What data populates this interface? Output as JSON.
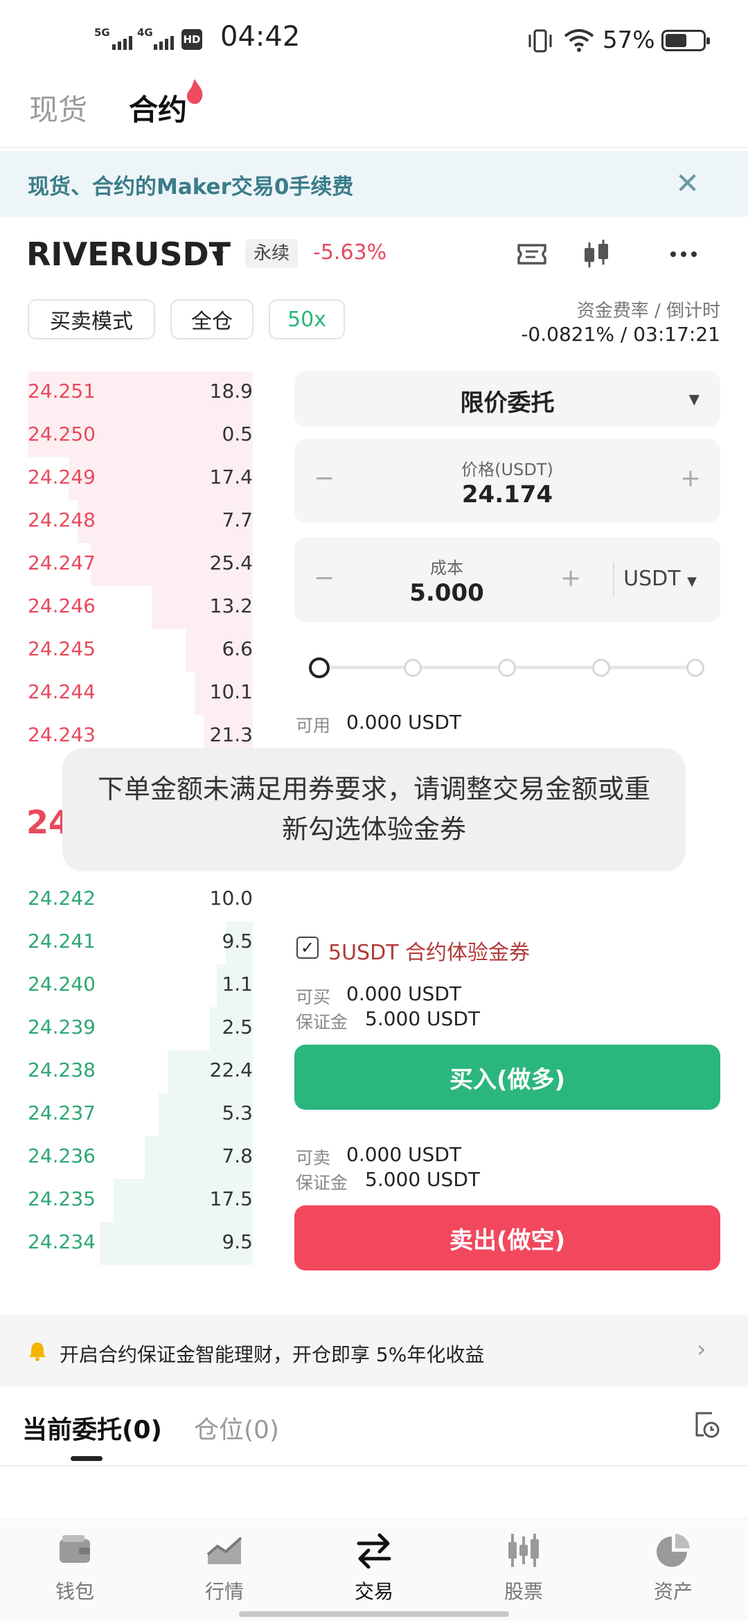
{
  "status_bar": {
    "net1": "5G",
    "net2": "4G",
    "hd": "HD",
    "time": "04:42",
    "battery": "57%"
  },
  "top_tabs": {
    "spot": "现货",
    "contract": "合约"
  },
  "banner": {
    "text": "现货、合约的Maker交易0手续费",
    "close": "✕"
  },
  "pair": {
    "symbol": "RIVERUSDT",
    "type_tag": "永续",
    "change": "-5.63%"
  },
  "mode_pills": {
    "mode": "买卖模式",
    "margin": "全仓",
    "leverage": "50x"
  },
  "funding": {
    "label": "资金费率 / 倒计时",
    "value": "-0.0821% / 03:17:21"
  },
  "asks": [
    {
      "price": "24.251",
      "qty": "18.9",
      "depth": 1.0
    },
    {
      "price": "24.250",
      "qty": "0.5",
      "depth": 1.0
    },
    {
      "price": "24.249",
      "qty": "17.4",
      "depth": 0.82
    },
    {
      "price": "24.248",
      "qty": "7.7",
      "depth": 0.78
    },
    {
      "price": "24.247",
      "qty": "25.4",
      "depth": 0.72
    },
    {
      "price": "24.246",
      "qty": "13.2",
      "depth": 0.45
    },
    {
      "price": "24.245",
      "qty": "6.6",
      "depth": 0.3
    },
    {
      "price": "24.244",
      "qty": "10.1",
      "depth": 0.26
    },
    {
      "price": "24.243",
      "qty": "21.3",
      "depth": 0.22
    }
  ],
  "last_price": "24",
  "bids": [
    {
      "price": "24.242",
      "qty": "10.0",
      "depth": 0.0
    },
    {
      "price": "24.241",
      "qty": "9.5",
      "depth": 0.12
    },
    {
      "price": "24.240",
      "qty": "1.1",
      "depth": 0.16
    },
    {
      "price": "24.239",
      "qty": "2.5",
      "depth": 0.19
    },
    {
      "price": "24.238",
      "qty": "22.4",
      "depth": 0.38
    },
    {
      "price": "24.237",
      "qty": "5.3",
      "depth": 0.42
    },
    {
      "price": "24.236",
      "qty": "7.8",
      "depth": 0.48
    },
    {
      "price": "24.235",
      "qty": "17.5",
      "depth": 0.62
    },
    {
      "price": "24.234",
      "qty": "9.5",
      "depth": 0.68
    }
  ],
  "order": {
    "type": "限价委托",
    "price_label": "价格(USDT)",
    "price_value": "24.174",
    "cost_label": "成本",
    "cost_value": "5.000",
    "unit": "USDT",
    "minus": "−",
    "plus": "+",
    "available_label": "可用",
    "available_value": "0.000 USDT"
  },
  "toast": {
    "text": "下单金额未满足用券要求，请调整交易金额或重新勾选体验金券"
  },
  "coupon": {
    "check": "✓",
    "label": "5USDT 合约体验金券"
  },
  "buy_info": {
    "can_label": "可买",
    "can_value": "0.000 USDT",
    "margin_label": "保证金",
    "margin_value": "5.000 USDT"
  },
  "sell_info": {
    "can_label": "可卖",
    "can_value": "0.000 USDT",
    "margin_label": "保证金",
    "margin_value": "5.000 USDT"
  },
  "buttons": {
    "buy": "买入(做多)",
    "sell": "卖出(做空)"
  },
  "promo": {
    "text": "开启合约保证金智能理财，开仓即享 5%年化收益",
    "arrow": "›"
  },
  "orders_tabs": {
    "open": "当前委托(0)",
    "positions": "仓位(0)"
  },
  "bottom_nav": [
    {
      "label": "钱包",
      "icon": "wallet-icon"
    },
    {
      "label": "行情",
      "icon": "chart-icon"
    },
    {
      "label": "交易",
      "icon": "swap-icon"
    },
    {
      "label": "股票",
      "icon": "stocks-icon"
    },
    {
      "label": "资产",
      "icon": "pie-icon"
    }
  ],
  "colors": {
    "ask": "#e8495d",
    "bid": "#2ba773",
    "buy_button": "#2bb67d",
    "sell_button": "#f2485e",
    "banner_text": "#3a7d8a"
  }
}
